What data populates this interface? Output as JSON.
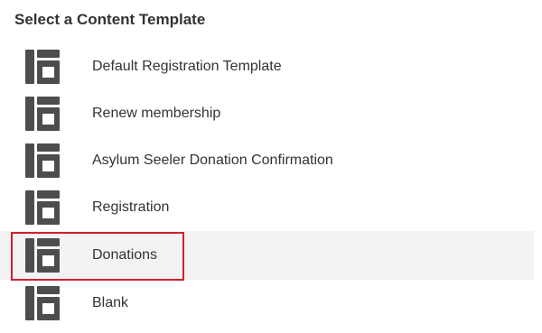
{
  "panel": {
    "title": "Select a Content Template"
  },
  "templates": [
    {
      "label": "Default Registration Template",
      "icon": "layout-template-icon",
      "selected": false
    },
    {
      "label": "Renew membership",
      "icon": "layout-template-icon",
      "selected": false
    },
    {
      "label": "Asylum Seeler Donation Confirmation",
      "icon": "layout-template-icon",
      "selected": false
    },
    {
      "label": "Registration",
      "icon": "layout-template-icon",
      "selected": false
    },
    {
      "label": "Donations",
      "icon": "layout-template-icon",
      "selected": true
    },
    {
      "label": "Blank",
      "icon": "layout-template-icon",
      "selected": false
    }
  ],
  "colors": {
    "icon": "#4d4d4d",
    "text": "#333333",
    "hover_background": "#f3f3f4",
    "highlight_border": "#d0202e"
  }
}
